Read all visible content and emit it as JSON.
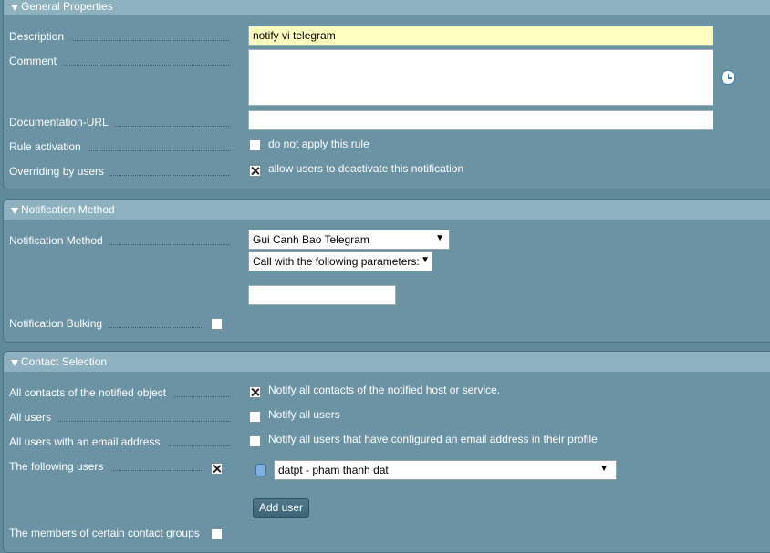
{
  "general": {
    "title": "General Properties",
    "description_label": "Description",
    "description_value": "notify vi telegram",
    "comment_label": "Comment",
    "comment_value": "",
    "doc_url_label": "Documentation-URL",
    "doc_url_value": "",
    "rule_activation_label": "Rule activation",
    "rule_activation_option": "do not apply this rule",
    "overriding_label": "Overriding by users",
    "overriding_option": "allow users to deactivate this notification"
  },
  "notification": {
    "title": "Notification Method",
    "method_label": "Notification Method",
    "method_selected": "Gui Canh Bao Telegram",
    "param_mode_selected": "Call with the following parameters:",
    "param_value": "",
    "bulking_label": "Notification Bulking"
  },
  "contacts": {
    "title": "Contact Selection",
    "all_contacts_label": "All contacts of the notified object",
    "all_contacts_option": "Notify all contacts of the notified host or service.",
    "all_users_label": "All users",
    "all_users_option": "Notify all users",
    "email_users_label": "All users with an email address",
    "email_users_option": "Notify all users that have configured an email address in their profile",
    "following_users_label": "The following users",
    "user_selected": "datpt - pham thanh dat",
    "add_user_button": "Add user",
    "contact_groups_label": "The members of certain contact groups"
  },
  "icons": {
    "expand": "triangle-down-icon",
    "comment_helper": "clock-icon",
    "user_delete": "trash-icon",
    "dropdown": "chevron-down-icon"
  },
  "colors": {
    "background": "#5f8a9a",
    "section_header": "#8eb1bf",
    "highlight_field": "#ffffc0"
  }
}
